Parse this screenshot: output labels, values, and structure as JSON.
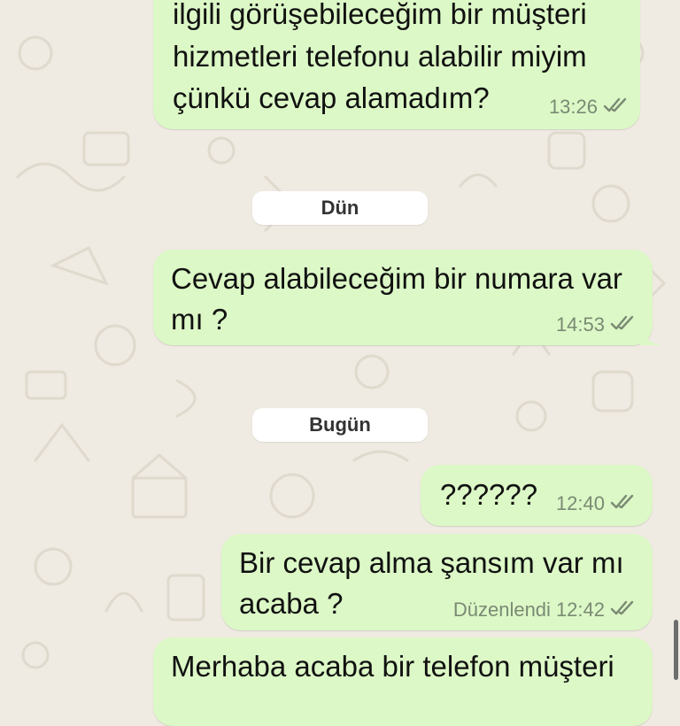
{
  "messages": [
    {
      "lines": [
        "ilgili görüşebileceğim bir müşteri",
        "hizmetleri telefonu alabilir miyim",
        "çünkü cevap alamadım?"
      ],
      "time": "13:26"
    },
    {
      "lines": [
        "Cevap alabileceğim bir numara var",
        "mı ?"
      ],
      "time": "14:53"
    },
    {
      "lines": [
        "??????"
      ],
      "time": "12:40"
    },
    {
      "lines": [
        "Bir cevap alma şansım var mı",
        "acaba ?"
      ],
      "edited": "Düzenlendi",
      "time": "12:42"
    },
    {
      "lines": [
        "Merhaba acaba bir telefon müşteri"
      ]
    }
  ],
  "date_separators": {
    "yesterday": "Dün",
    "today": "Bugün"
  },
  "colors": {
    "outgoing_bubble": "#dcf8c6",
    "background": "#efeae2",
    "meta_text": "#7a8a74"
  },
  "icons": {
    "read_receipt": "double-check-icon"
  }
}
